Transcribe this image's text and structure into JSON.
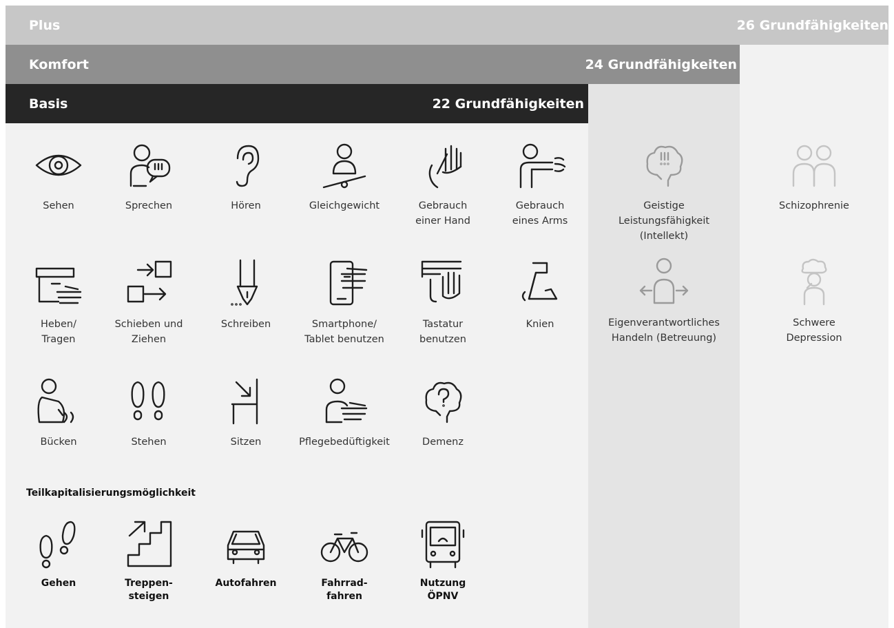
{
  "tiers": {
    "plus": {
      "name": "Plus",
      "count": "26 Grundfähigkeiten"
    },
    "komfort": {
      "name": "Komfort",
      "count": "24 Grundfähigkeiten"
    },
    "basis": {
      "name": "Basis",
      "count": "22 Grundfähigkeiten"
    }
  },
  "basis_items": [
    {
      "label": "Sehen",
      "icon": "eye-icon"
    },
    {
      "label": "Sprechen",
      "icon": "speech-bubble-person-icon"
    },
    {
      "label": "Hören",
      "icon": "ear-icon"
    },
    {
      "label": "Gleichgewicht",
      "icon": "balance-person-icon"
    },
    {
      "label": "Gebrauch\neiner Hand",
      "icon": "hand-icon"
    },
    {
      "label": "Gebrauch\neines Arms",
      "icon": "arm-icon"
    },
    {
      "label": "Heben/\nTragen",
      "icon": "box-lift-icon"
    },
    {
      "label": "Schieben und\nZiehen",
      "icon": "push-pull-icon"
    },
    {
      "label": "Schreiben",
      "icon": "pen-icon"
    },
    {
      "label": "Smartphone/\nTablet benutzen",
      "icon": "smartphone-icon"
    },
    {
      "label": "Tastatur\nbenutzen",
      "icon": "keyboard-icon"
    },
    {
      "label": "Knien",
      "icon": "kneel-icon"
    },
    {
      "label": "Bücken",
      "icon": "bend-icon"
    },
    {
      "label": "Stehen",
      "icon": "footprints-icon"
    },
    {
      "label": "Sitzen",
      "icon": "chair-icon"
    },
    {
      "label": "Pflegebedüftigkeit",
      "icon": "care-person-icon"
    },
    {
      "label": "Demenz",
      "icon": "brain-question-icon"
    }
  ],
  "sub_heading": "Teilkapitalisierungsmöglichkeit",
  "partial_items": [
    {
      "label": "Gehen",
      "icon": "walk-footprints-icon"
    },
    {
      "label": "Treppen-\nsteigen",
      "icon": "stairs-icon"
    },
    {
      "label": "Autofahren",
      "icon": "car-icon"
    },
    {
      "label": "Fahrrad-\nfahren",
      "icon": "bicycle-icon"
    },
    {
      "label": "Nutzung\nÖPNV",
      "icon": "bus-icon"
    }
  ],
  "komfort_items": [
    {
      "label": "Geistige\nLeistungsfähigkeit\n(Intellekt)",
      "icon": "brain-alert-icon"
    },
    {
      "label": "Eigenverantwortliches\nHandeln (Betreuung)",
      "icon": "person-arrows-icon"
    }
  ],
  "plus_items": [
    {
      "label": "Schizophrenie",
      "icon": "two-persons-icon"
    },
    {
      "label": "Schwere\nDepression",
      "icon": "person-cloud-icon"
    }
  ]
}
